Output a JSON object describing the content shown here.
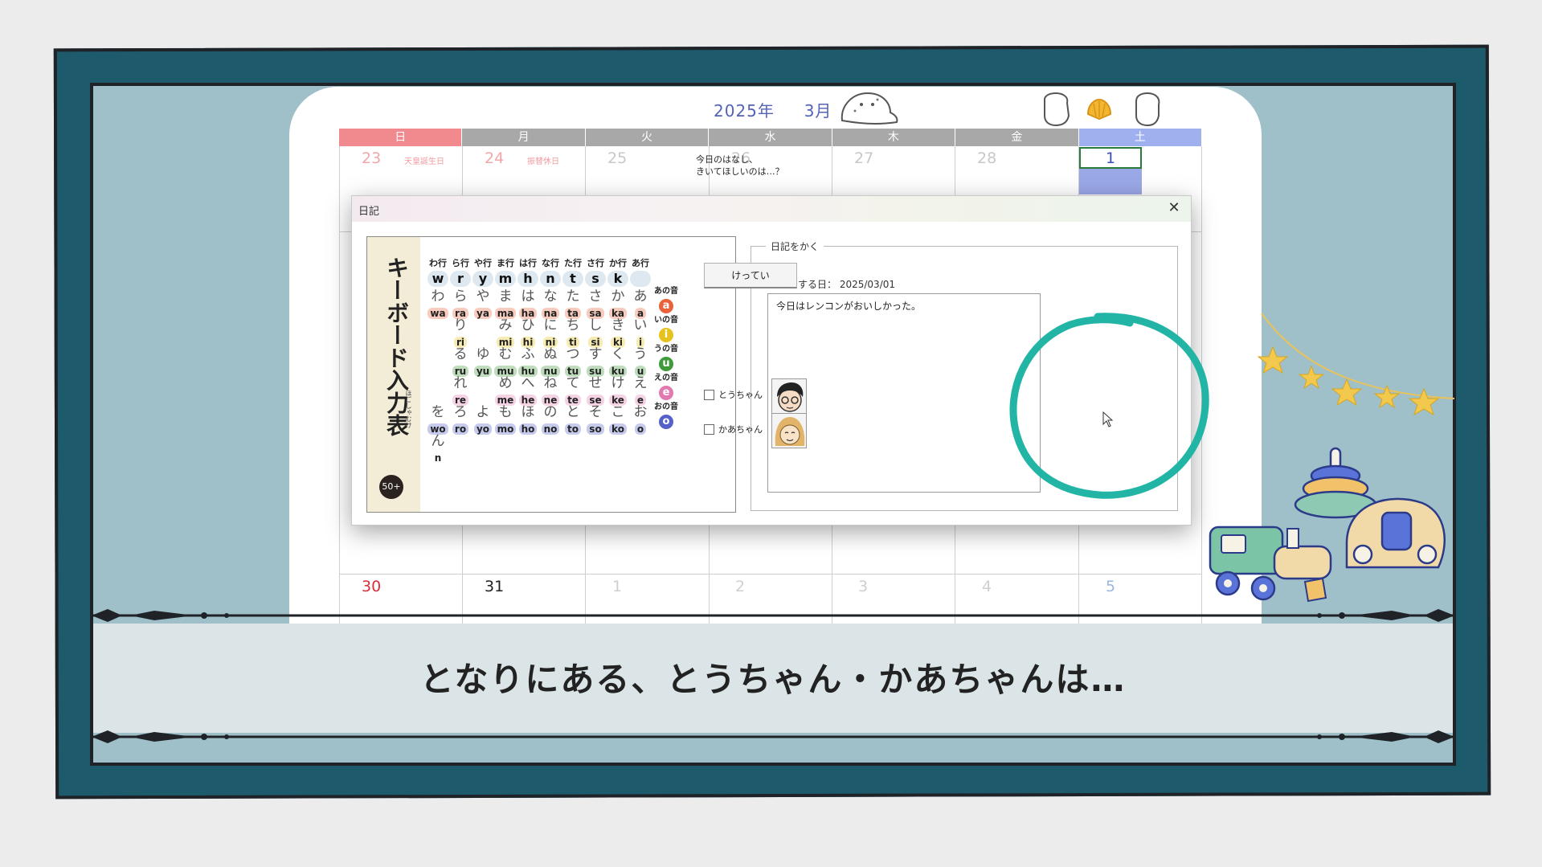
{
  "calendar": {
    "year_label": "2025年",
    "month_label": "3月",
    "weekdays": [
      "日",
      "月",
      "火",
      "水",
      "木",
      "金",
      "土"
    ],
    "week1": {
      "days": [
        "23",
        "24",
        "25",
        "26",
        "27",
        "28",
        "1"
      ],
      "holidays": {
        "sun": "天皇誕生日",
        "mon": "振替休日"
      }
    },
    "week_last": {
      "days": [
        "30",
        "31",
        "1",
        "2",
        "3",
        "4",
        "5"
      ]
    }
  },
  "dialog": {
    "title": "日記",
    "close_glyph": "✕",
    "diary_group_label": "日記をかく",
    "date_label": "入力をする日：",
    "date_value": "2025/03/01",
    "diary_text": "今日はレンコンがおいしかった。",
    "ask_line1": "今日のはなし、",
    "ask_line2": "きいてほしいのは…？",
    "option_father": "とうちゃん",
    "option_mother": "かあちゃん",
    "decide_button": "けってい"
  },
  "keyboard_chart": {
    "title": "キーボード入力表",
    "subtitle": "ほごしゃむけ",
    "badge": "50+",
    "gyou_labels": [
      "わ行",
      "ら行",
      "や行",
      "ま行",
      "は行",
      "な行",
      "た行",
      "さ行",
      "か行",
      "あ行"
    ],
    "consonants": [
      "w",
      "r",
      "y",
      "m",
      "h",
      "n",
      "t",
      "s",
      "k",
      ""
    ],
    "rows": [
      {
        "vowel_label": "あの音",
        "vowel": "a",
        "color": "#e8623a",
        "cells": [
          [
            "わ",
            "wa"
          ],
          [
            "ら",
            "ra"
          ],
          [
            "や",
            "ya"
          ],
          [
            "ま",
            "ma"
          ],
          [
            "は",
            "ha"
          ],
          [
            "な",
            "na"
          ],
          [
            "た",
            "ta"
          ],
          [
            "さ",
            "sa"
          ],
          [
            "か",
            "ka"
          ],
          [
            "あ",
            "a"
          ]
        ]
      },
      {
        "vowel_label": "いの音",
        "vowel": "i",
        "color": "#e6c21e",
        "cells": [
          [
            "",
            ""
          ],
          [
            "り",
            "ri"
          ],
          [
            "",
            ""
          ],
          [
            "み",
            "mi"
          ],
          [
            "ひ",
            "hi"
          ],
          [
            "に",
            "ni"
          ],
          [
            "ち",
            "ti"
          ],
          [
            "し",
            "si"
          ],
          [
            "き",
            "ki"
          ],
          [
            "い",
            "i"
          ]
        ]
      },
      {
        "vowel_label": "うの音",
        "vowel": "u",
        "color": "#3f9a3a",
        "cells": [
          [
            "",
            ""
          ],
          [
            "る",
            "ru"
          ],
          [
            "ゆ",
            "yu"
          ],
          [
            "む",
            "mu"
          ],
          [
            "ふ",
            "hu"
          ],
          [
            "ぬ",
            "nu"
          ],
          [
            "つ",
            "tu"
          ],
          [
            "す",
            "su"
          ],
          [
            "く",
            "ku"
          ],
          [
            "う",
            "u"
          ]
        ]
      },
      {
        "vowel_label": "えの音",
        "vowel": "e",
        "color": "#e07ab0",
        "cells": [
          [
            "",
            ""
          ],
          [
            "れ",
            "re"
          ],
          [
            "",
            ""
          ],
          [
            "め",
            "me"
          ],
          [
            "へ",
            "he"
          ],
          [
            "ね",
            "ne"
          ],
          [
            "て",
            "te"
          ],
          [
            "せ",
            "se"
          ],
          [
            "け",
            "ke"
          ],
          [
            "え",
            "e"
          ]
        ]
      },
      {
        "vowel_label": "おの音",
        "vowel": "o",
        "color": "#5560c8",
        "cells": [
          [
            "を",
            "wo"
          ],
          [
            "ろ",
            "ro"
          ],
          [
            "よ",
            "yo"
          ],
          [
            "も",
            "mo"
          ],
          [
            "ほ",
            "ho"
          ],
          [
            "の",
            "no"
          ],
          [
            "と",
            "to"
          ],
          [
            "そ",
            "so"
          ],
          [
            "こ",
            "ko"
          ],
          [
            "お",
            "o"
          ]
        ]
      }
    ],
    "n_kana": "ん",
    "n_roma": "n"
  },
  "caption": "となりにある、とうちゃん・かあちゃんは…",
  "colors": {
    "frame": "#1d5a6c",
    "frame_inner": "#9fc0c9",
    "accent_teal": "#22b5a6",
    "calendar_title": "#5463b8",
    "sunday": "#f08a8f",
    "saturday": "#9fb0ef"
  },
  "icons": {
    "seal": "seal-icon",
    "shell": "shell-icon",
    "mic_left": "face-icon",
    "mic_right": "face-icon",
    "garland": "star-garland-icon",
    "toys": "toys-icon"
  }
}
